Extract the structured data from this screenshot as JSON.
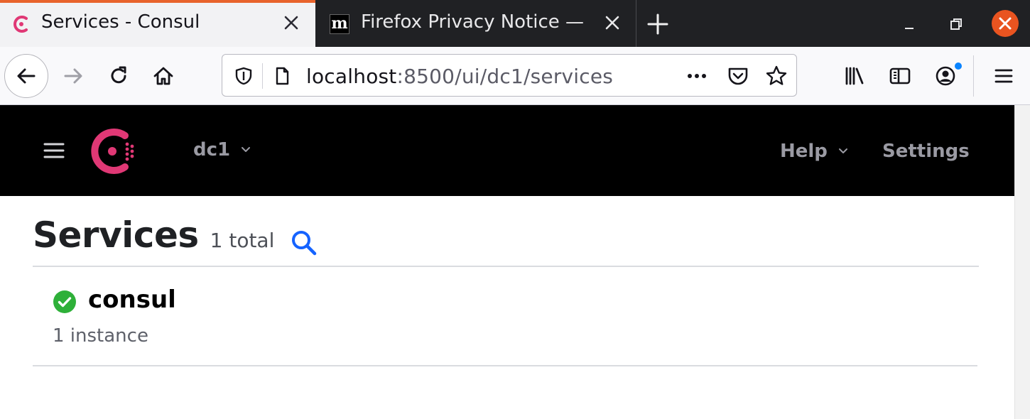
{
  "browser": {
    "tabs": [
      {
        "title": "Services - Consul",
        "favicon": "consul-icon",
        "active": true
      },
      {
        "title": "Firefox Privacy Notice —",
        "favicon": "mozilla-m-icon",
        "favicon_text": "m",
        "active": false
      }
    ],
    "url": {
      "host": "localhost",
      "rest": ":8500/ui/dc1/services"
    },
    "toolbar_icons": [
      "back-arrow-icon",
      "forward-arrow-icon",
      "reload-icon",
      "home-icon",
      "shield-icon",
      "page-icon",
      "more-dots-icon",
      "pocket-icon",
      "star-icon",
      "library-icon",
      "sidebar-icon",
      "account-icon",
      "menu-icon"
    ]
  },
  "consul_header": {
    "datacenter": "dc1",
    "help_label": "Help",
    "settings_label": "Settings"
  },
  "main": {
    "title": "Services",
    "count_text": "1 total",
    "services": [
      {
        "name": "consul",
        "status": "passing",
        "instances_text": "1 instance"
      }
    ]
  },
  "colors": {
    "brand": "#e03875",
    "header_bg": "#000000",
    "search_icon": "#1563ff",
    "status_passing": "#2eb039",
    "firefox_tab_accent": "#e8632c",
    "window_close": "#e95420"
  }
}
